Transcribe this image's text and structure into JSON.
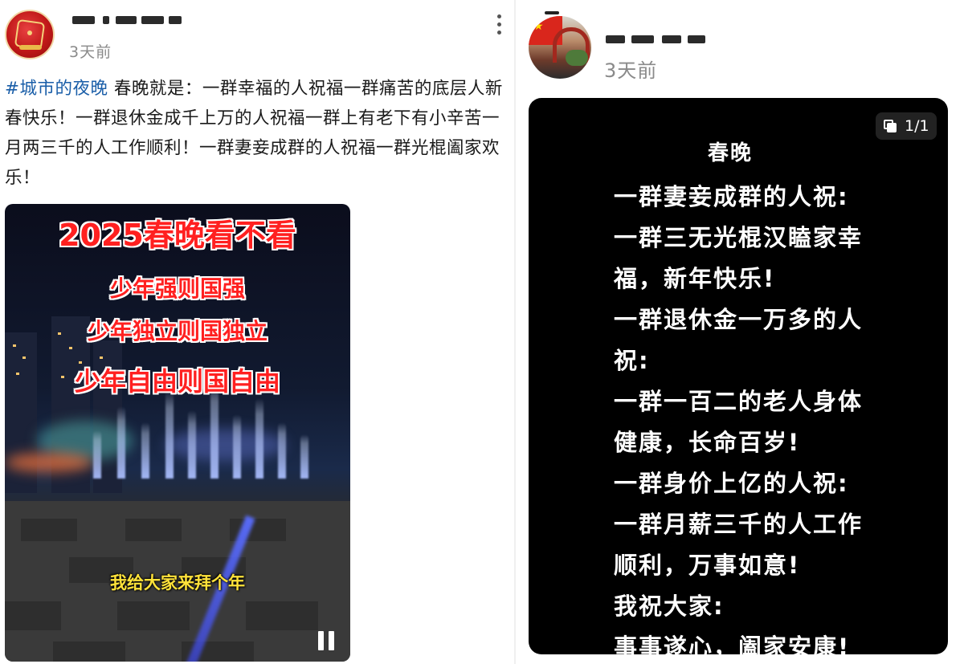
{
  "left_post": {
    "author_name": "",
    "time": "3天前",
    "hashtag": "#城市的夜晚",
    "body": " 春晚就是：一群幸福的人祝福一群痛苦的底层人新春快乐！一群退休金成千上万的人祝福一群上有老下有小辛苦一月两三千的人工作顺利！一群妻妾成群的人祝福一群光棍阖家欢乐！",
    "video": {
      "title": "2025春晚看不看",
      "lines": [
        "少年强则国强",
        "少年独立则国独立",
        "少年自由则国自由"
      ],
      "subtitle": "我给大家来拜个年",
      "state": "playing"
    }
  },
  "right_post": {
    "author_name": "",
    "time": "3天前",
    "image_counter": "1/1",
    "poem_title": "春晚",
    "poem_lines": [
      "一群妻妾成群的人祝:",
      "一群三无光棍汉瞌家幸",
      "福，新年快乐!",
      "一群退休金一万多的人",
      "祝:",
      "一群一百二的老人身体",
      "健康，长命百岁!",
      "一群身价上亿的人祝:",
      "一群月薪三千的人工作",
      "顺利，万事如意!",
      "我祝大家:",
      "事事遂心，阖家安康!"
    ]
  },
  "colors": {
    "hashtag": "#1a5ea8",
    "video_title": "#ff2020",
    "video_subtitle": "#ffe23a",
    "card_bg": "#000000",
    "meta_text": "#8a8a8a"
  },
  "icons": [
    "more-vertical-icon",
    "pause-icon",
    "multi-image-icon"
  ]
}
